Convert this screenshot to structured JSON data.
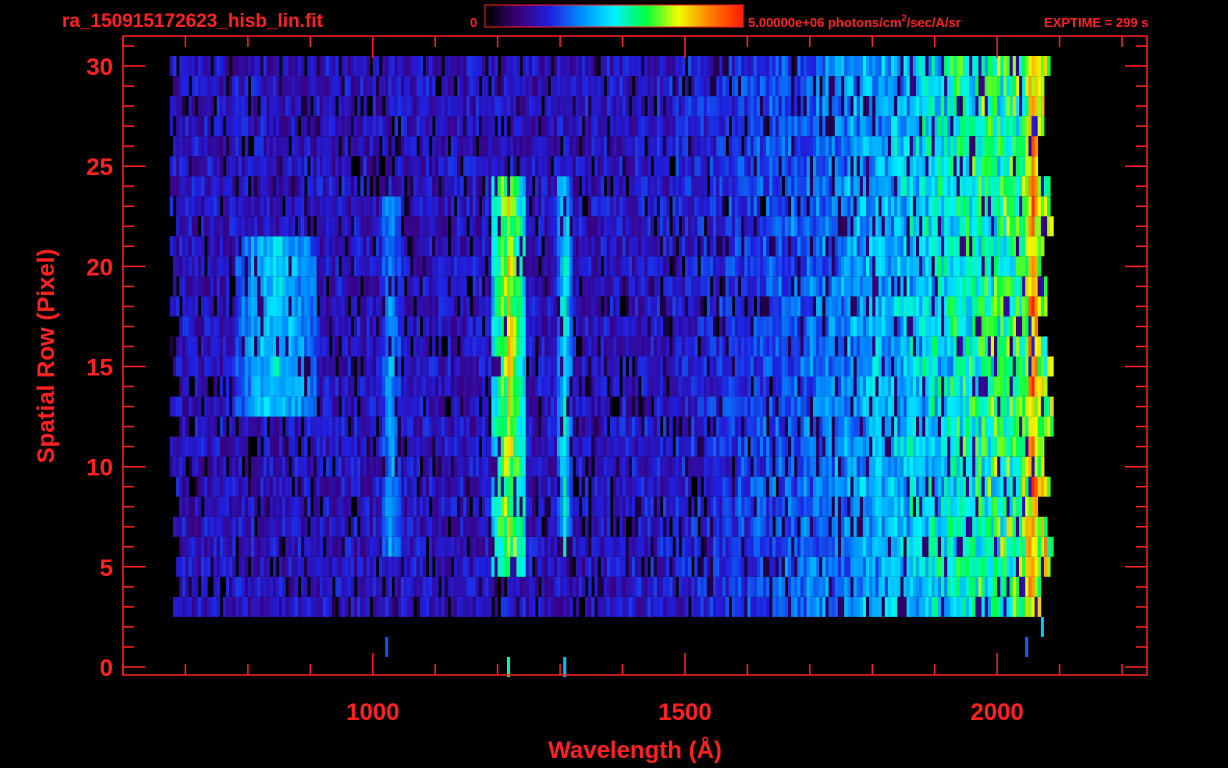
{
  "header": {
    "filename": "ra_150915172623_hisb_lin.fit",
    "colorbar_min": "0",
    "colorbar_max_prefix": "5.00000e+06 photons/cm",
    "colorbar_max_sup": "2",
    "colorbar_max_suffix": "/sec/A/sr",
    "exptime": "EXPTIME = 299 s"
  },
  "colors": {
    "axis": "#ff2020",
    "background": "#000000",
    "colormap": [
      "#000000",
      "#3a007a",
      "#2020e0",
      "#0090ff",
      "#00f0ff",
      "#00ff40",
      "#f0ff00",
      "#ff8000",
      "#ff2000"
    ]
  },
  "chart_data": {
    "type": "heatmap",
    "xlabel": "Wavelength (Å)",
    "ylabel": "Spatial Row (Pixel)",
    "xlim": [
      600,
      2240
    ],
    "ylim": [
      -0.4,
      31.5
    ],
    "xticks": [
      1000,
      1500,
      2000
    ],
    "xtick_labels": [
      "1000",
      "1500",
      "2000"
    ],
    "x_minor_step": 100,
    "yticks": [
      0,
      5,
      10,
      15,
      20,
      25,
      30
    ],
    "ytick_labels": [
      "0",
      "5",
      "10",
      "15",
      "20",
      "25",
      "30"
    ],
    "y_minor_step": 1,
    "colorbar": {
      "min": 0,
      "max": 5000000,
      "unit": "photons/cm^2/sec/A/sr"
    },
    "data_extent": {
      "x": [
        675,
        2095
      ],
      "y": [
        3,
        30
      ]
    },
    "features": [
      {
        "center": 1216,
        "width": 45,
        "rows": [
          5,
          24
        ],
        "level": 0.72
      },
      {
        "center": 1304,
        "width": 20,
        "rows": [
          6,
          24
        ],
        "level": 0.5
      },
      {
        "center": 1027,
        "width": 28,
        "rows": [
          6,
          23
        ],
        "level": 0.4
      },
      {
        "center": 843,
        "width": 110,
        "rows": [
          13,
          21
        ],
        "level": 0.48
      },
      {
        "center": 1805,
        "width": 30,
        "rows": [
          6,
          23
        ],
        "level": 0.45
      },
      {
        "center": 2055,
        "width": 30,
        "rows": [
          2,
          30
        ],
        "level": 0.85
      }
    ]
  }
}
